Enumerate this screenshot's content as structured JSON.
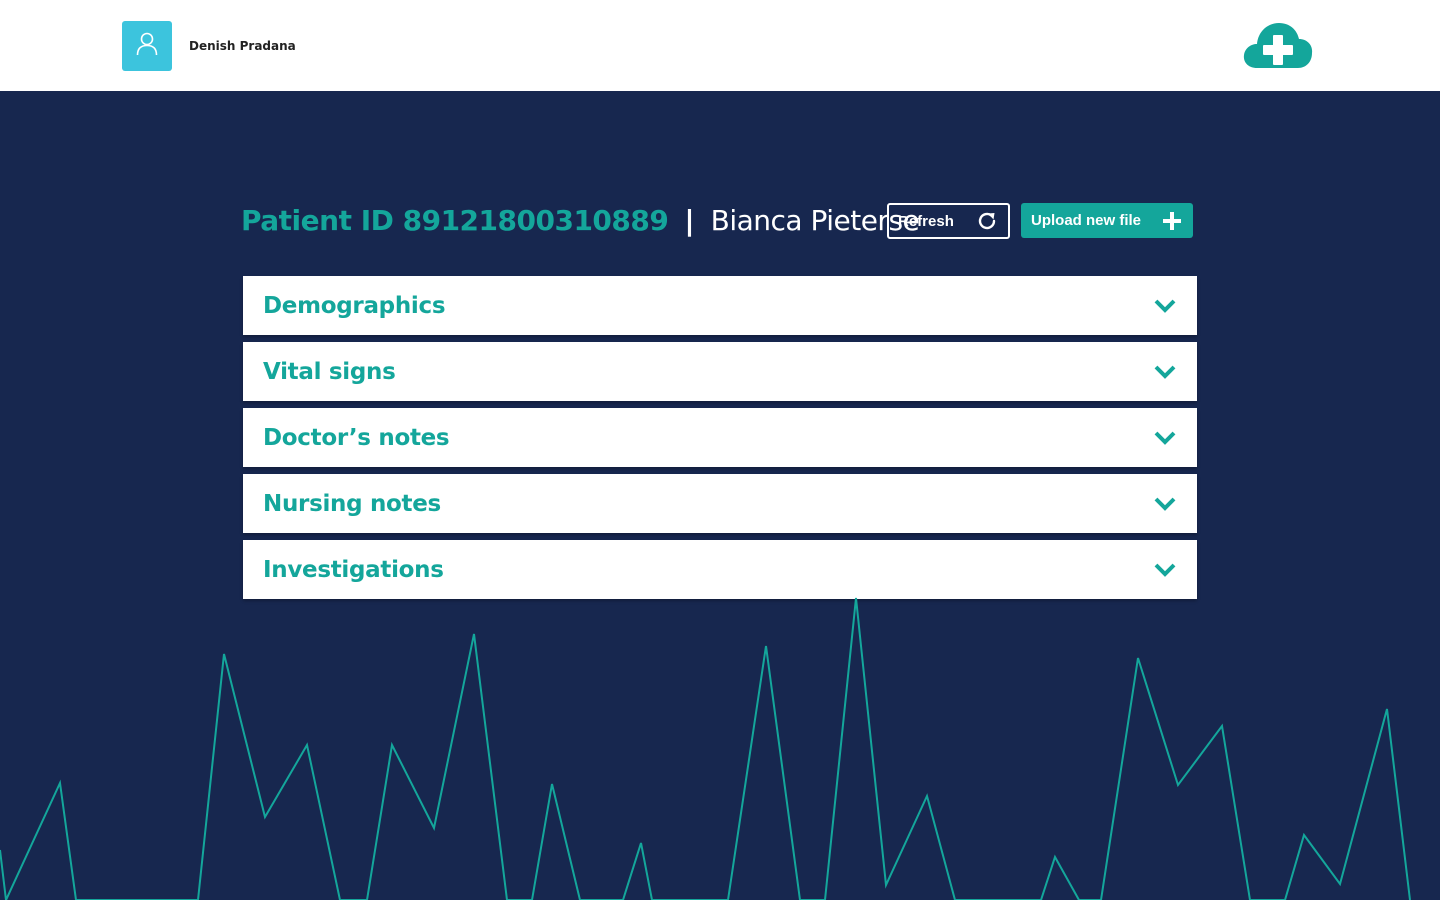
{
  "header": {
    "user_name": "Denish Pradana",
    "avatar_icon": "user-icon",
    "logo_icon": "cloud-medical-cross-icon"
  },
  "patient": {
    "id_label": "Patient ID 89121800310889",
    "separator": "|",
    "name": "Bianca Pieterse"
  },
  "actions": {
    "refresh_label": "Refresh",
    "refresh_icon": "refresh-icon",
    "upload_label": "Upload new file",
    "upload_icon": "plus-icon"
  },
  "sections": [
    {
      "label": "Demographics"
    },
    {
      "label": "Vital signs"
    },
    {
      "label": "Doctor’s notes"
    },
    {
      "label": "Nursing notes"
    },
    {
      "label": "Investigations"
    }
  ],
  "colors": {
    "background": "#17274f",
    "accent": "#14a69b",
    "avatar": "#3cc4dd",
    "white": "#ffffff"
  }
}
